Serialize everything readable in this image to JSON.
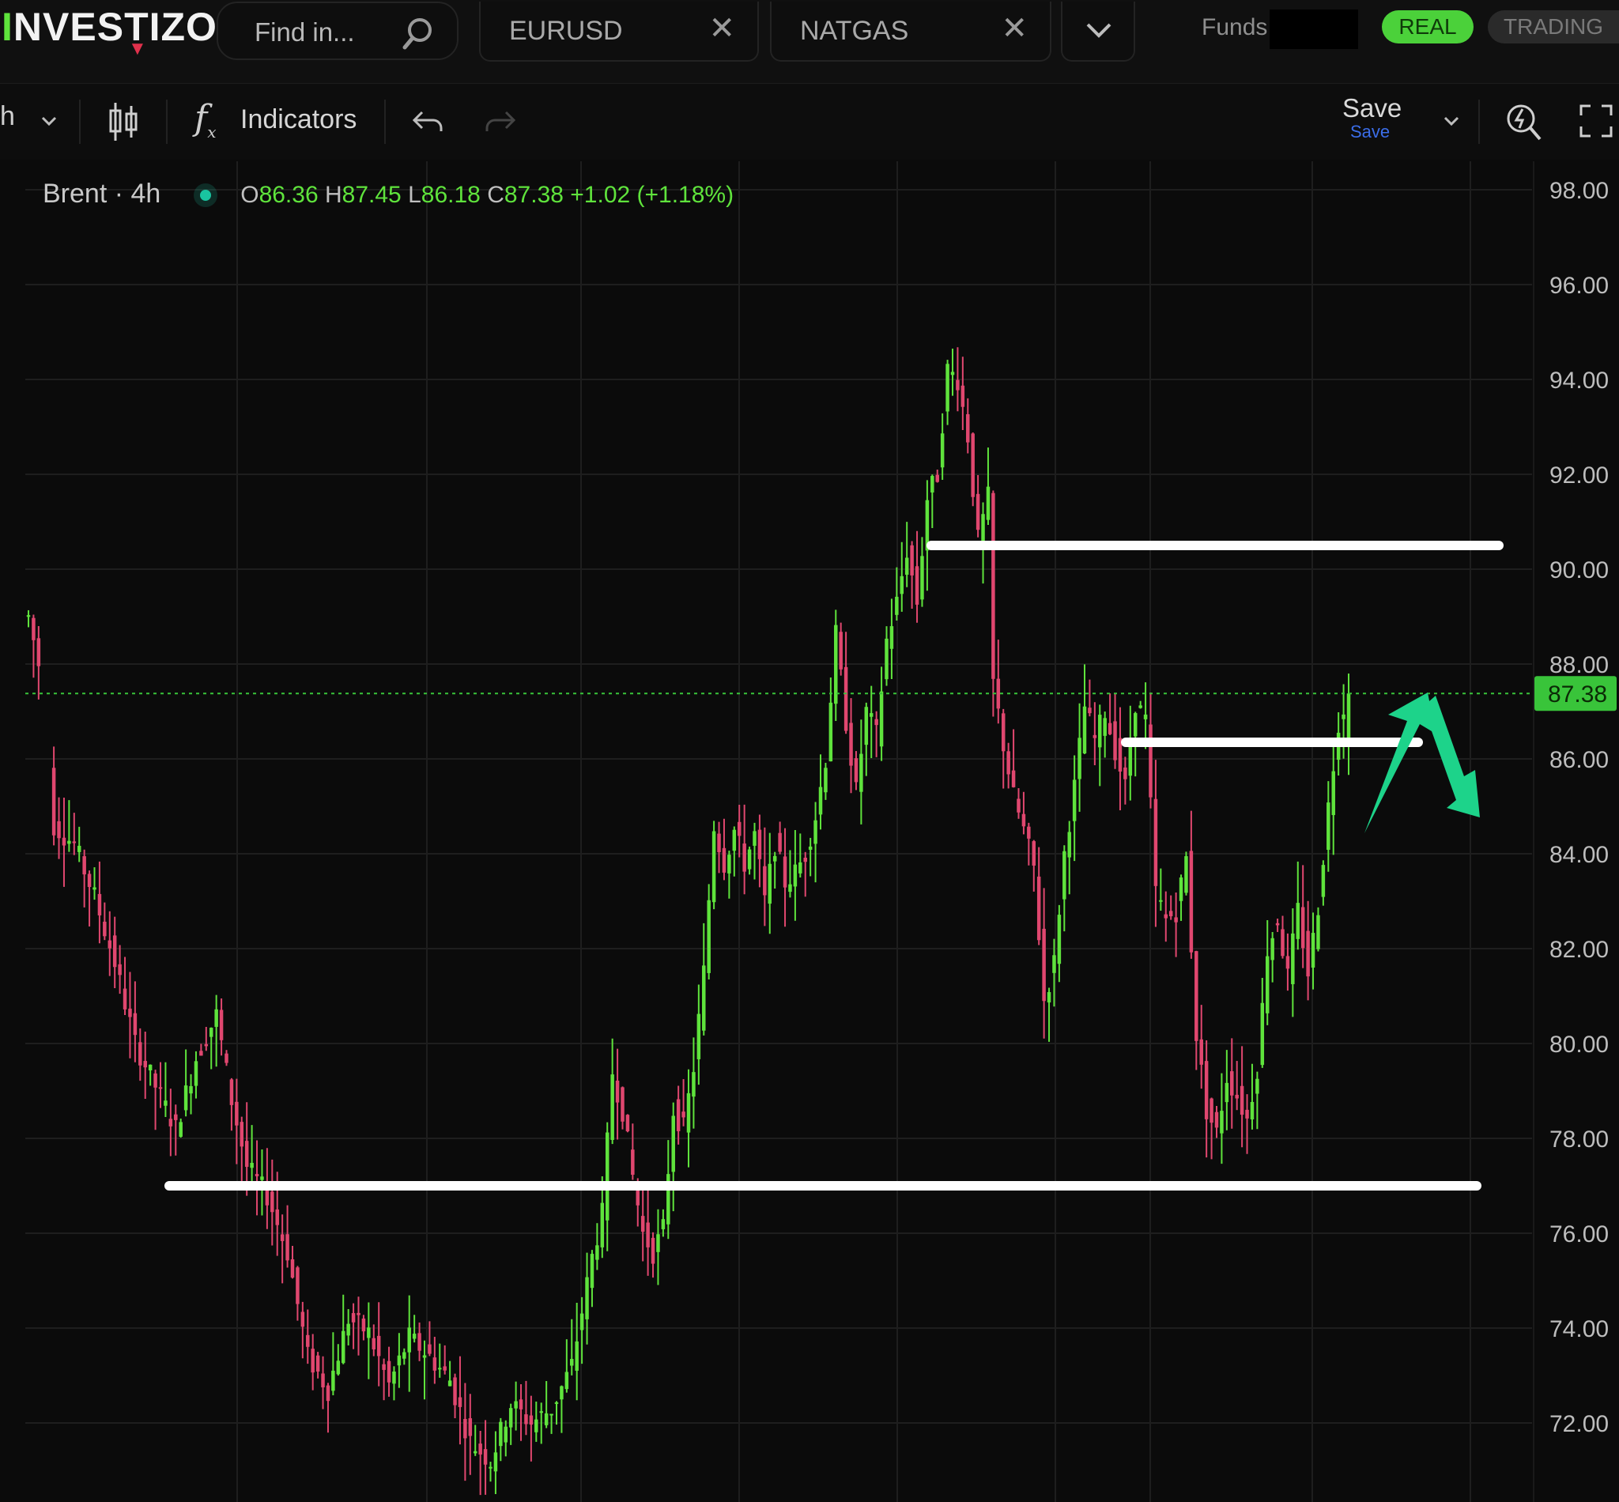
{
  "header": {
    "logo": "INVESTIZO",
    "search_placeholder": "Find in...",
    "tabs": [
      {
        "label": "EURUSD"
      },
      {
        "label": "NATGAS"
      }
    ],
    "funds_label": "Funds:",
    "modes": {
      "real": "REAL",
      "trading": "TRADING"
    }
  },
  "toolbar": {
    "timeframe": "h",
    "indicators_label": "Indicators",
    "save_label": "Save",
    "save_sub_label": "Save"
  },
  "legend": {
    "symbol": "Brent · 4h",
    "open_label": "O",
    "open": "86.36",
    "high_label": "H",
    "high": "87.45",
    "low_label": "L",
    "low": "86.18",
    "close_label": "C",
    "close": "87.38",
    "change": "+1.02 (+1.18%)"
  },
  "colors": {
    "up": "#5fe33c",
    "down": "#e0476f",
    "accent": "#1dd38a",
    "last_price_bg": "#39c43a"
  },
  "chart_data": {
    "type": "candlestick",
    "symbol": "Brent",
    "interval": "4h",
    "ylim": [
      71,
      99
    ],
    "y_ticks": [
      "98.00",
      "96.00",
      "94.00",
      "92.00",
      "90.00",
      "88.00",
      "86.00",
      "84.00",
      "82.00",
      "80.00",
      "78.00",
      "76.00",
      "74.00",
      "72.00"
    ],
    "last_price": 87.38,
    "last_price_label": "87.38",
    "path_points": [
      [
        0,
        89.0
      ],
      [
        2,
        88.0
      ],
      [
        5,
        84.6
      ],
      [
        9,
        84.2
      ],
      [
        13,
        83.1
      ],
      [
        17,
        81.7
      ],
      [
        21,
        80.0
      ],
      [
        25,
        79.1
      ],
      [
        29,
        78.2
      ],
      [
        33,
        79.7
      ],
      [
        37,
        80.6
      ],
      [
        40,
        78.8
      ],
      [
        43,
        77.4
      ],
      [
        47,
        76.8
      ],
      [
        51,
        75.6
      ],
      [
        55,
        73.4
      ],
      [
        59,
        72.7
      ],
      [
        63,
        74.2
      ],
      [
        67,
        73.9
      ],
      [
        71,
        72.8
      ],
      [
        75,
        73.8
      ],
      [
        79,
        73.4
      ],
      [
        83,
        72.9
      ],
      [
        87,
        71.6
      ],
      [
        91,
        71.2
      ],
      [
        95,
        72.4
      ],
      [
        99,
        72.0
      ],
      [
        103,
        72.3
      ],
      [
        107,
        73.2
      ],
      [
        111,
        75.5
      ],
      [
        113,
        76.4
      ],
      [
        115,
        79.4
      ],
      [
        117,
        78.6
      ],
      [
        119,
        77.2
      ],
      [
        121,
        76.0
      ],
      [
        123,
        75.6
      ],
      [
        125,
        76.1
      ],
      [
        127,
        78.6
      ],
      [
        129,
        78.2
      ],
      [
        131,
        79.5
      ],
      [
        133,
        81.5
      ],
      [
        135,
        84.6
      ],
      [
        137,
        83.8
      ],
      [
        139,
        84.5
      ],
      [
        141,
        83.8
      ],
      [
        143,
        84.4
      ],
      [
        145,
        83.0
      ],
      [
        147,
        84.2
      ],
      [
        149,
        83.4
      ],
      [
        151,
        83.6
      ],
      [
        153,
        84.0
      ],
      [
        155,
        84.8
      ],
      [
        157,
        86.0
      ],
      [
        159,
        88.6
      ],
      [
        161,
        86.8
      ],
      [
        163,
        85.3
      ],
      [
        165,
        87.0
      ],
      [
        167,
        86.5
      ],
      [
        169,
        88.5
      ],
      [
        171,
        89.3
      ],
      [
        173,
        90.4
      ],
      [
        175,
        89.3
      ],
      [
        177,
        91.5
      ],
      [
        179,
        92.0
      ],
      [
        181,
        94.2
      ],
      [
        183,
        94.0
      ],
      [
        185,
        92.8
      ],
      [
        187,
        90.6
      ],
      [
        189,
        91.5
      ],
      [
        190,
        87.6
      ],
      [
        192,
        86.3
      ],
      [
        194,
        85.2
      ],
      [
        196,
        84.5
      ],
      [
        198,
        83.7
      ],
      [
        200,
        80.9
      ],
      [
        202,
        81.7
      ],
      [
        204,
        84.0
      ],
      [
        206,
        85.4
      ],
      [
        208,
        87.1
      ],
      [
        210,
        86.4
      ],
      [
        212,
        87.0
      ],
      [
        214,
        86.2
      ],
      [
        216,
        85.4
      ],
      [
        218,
        87.2
      ],
      [
        220,
        86.8
      ],
      [
        222,
        83.2
      ],
      [
        224,
        82.6
      ],
      [
        226,
        82.8
      ],
      [
        228,
        83.9
      ],
      [
        230,
        80.2
      ],
      [
        232,
        78.6
      ],
      [
        234,
        78.1
      ],
      [
        236,
        79.3
      ],
      [
        238,
        78.9
      ],
      [
        240,
        78.4
      ],
      [
        242,
        79.5
      ],
      [
        244,
        82.0
      ],
      [
        246,
        82.6
      ],
      [
        248,
        81.4
      ],
      [
        250,
        82.8
      ],
      [
        252,
        81.5
      ],
      [
        254,
        82.9
      ],
      [
        256,
        85.0
      ],
      [
        258,
        86.8
      ],
      [
        260,
        87.38
      ]
    ],
    "drawn_levels": [
      {
        "price": 90.5
      },
      {
        "price": 86.35
      },
      {
        "price": 77.0
      }
    ]
  }
}
